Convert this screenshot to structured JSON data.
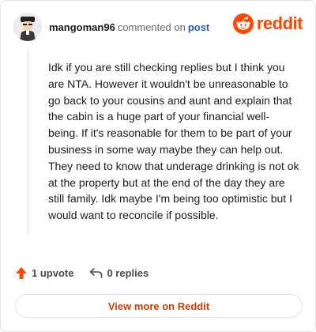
{
  "comment": {
    "username": "mangoman96",
    "action_text": "commented on",
    "post_link_label": "post",
    "body": "Idk if you are still checking replies but I think you are NTA. However it wouldn't be unreasonable to go back to your cousins and aunt and explain that the cabin is a huge part of your financial well-being. If it's reasonable for them to be part of your business in some way maybe they can help out. They need to know that underage drinking is not ok at the property but at the end of the day they are still family. Idk maybe I'm being too optimistic but I would want to reconcile if possible."
  },
  "brand": {
    "name": "reddit",
    "icon": "reddit-snoo-icon",
    "color": "#ff4500"
  },
  "stats": {
    "upvote_label": "1 upvote",
    "upvote_icon": "upvote-arrow-icon",
    "upvote_color": "#ff4500",
    "replies_label": "0 replies",
    "replies_icon": "reply-arrow-icon"
  },
  "actions": {
    "view_more_label": "View more on Reddit"
  }
}
